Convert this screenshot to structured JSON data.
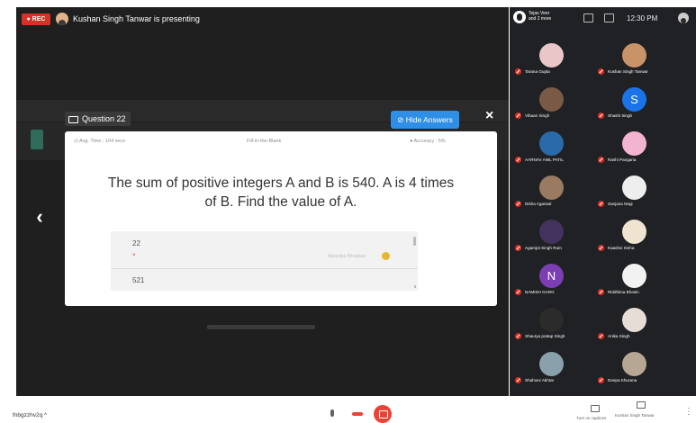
{
  "presenter_bar": {
    "rec_label": "● REC",
    "presenting_text": "Kushan Singh Tanwar is presenting"
  },
  "question": {
    "number_label": "Question 22",
    "hide_answers_label": "Hide Answers",
    "avg_time": "Avg. Time : 104 secs",
    "type": "Fill-in-the-Blank",
    "accuracy": "Accuracy : 5%",
    "text_line1": "The sum of positive integers A and B is 540. A is 4 times",
    "text_line2": "of B. Find the value of A.",
    "answers": [
      {
        "value": "22",
        "mark": "×",
        "student": "Aaradya Bhaskar"
      },
      {
        "value": "521"
      }
    ]
  },
  "participants_top": {
    "names_line1": "Tejas Veer",
    "names_line2": "and 2 more",
    "time": "12:30 PM"
  },
  "participants": [
    {
      "name": "Tarana Gupta",
      "color": "#e9c7c9",
      "initial": ""
    },
    {
      "name": "Kushan Singh Tanwar",
      "color": "#c89368",
      "initial": ""
    },
    {
      "name": "Vihaan Singh",
      "color": "#7a5a46",
      "initial": ""
    },
    {
      "name": "Shashi Singh",
      "color": "#1a73e8",
      "initial": "S"
    },
    {
      "name": "AARNAV ANIL PATIL",
      "color": "#2b6aa8",
      "initial": ""
    },
    {
      "name": "Rashi Pangaria",
      "color": "#f3b4d2",
      "initial": ""
    },
    {
      "name": "Disha Agarwal",
      "color": "#9a7b61",
      "initial": ""
    },
    {
      "name": "Sanjana Negi",
      "color": "#eeeeee",
      "initial": ""
    },
    {
      "name": "Agamjot Singh Rum",
      "color": "#43325e",
      "initial": ""
    },
    {
      "name": "Kaashvi Sinha",
      "color": "#efe4cf",
      "initial": ""
    },
    {
      "name": "NAMISH GARG",
      "color": "#7b3fb3",
      "initial": "N"
    },
    {
      "name": "Riddhima Bhasin",
      "color": "#f2f2f2",
      "initial": ""
    },
    {
      "name": "Shaurya pratap Singh",
      "color": "#2b2b2b",
      "initial": ""
    },
    {
      "name": "Anika Singh",
      "color": "#e6ddd6",
      "initial": ""
    },
    {
      "name": "Shahvez Akhtar",
      "color": "#8aa0ab",
      "initial": ""
    },
    {
      "name": "Deepa Khurana",
      "color": "#b6a694",
      "initial": ""
    }
  ],
  "footer": {
    "meeting_code": "fnbgzzhv2q ^",
    "captions_label": "Turn on captions",
    "presenter_label": "Kushan Singh Tanwar"
  }
}
